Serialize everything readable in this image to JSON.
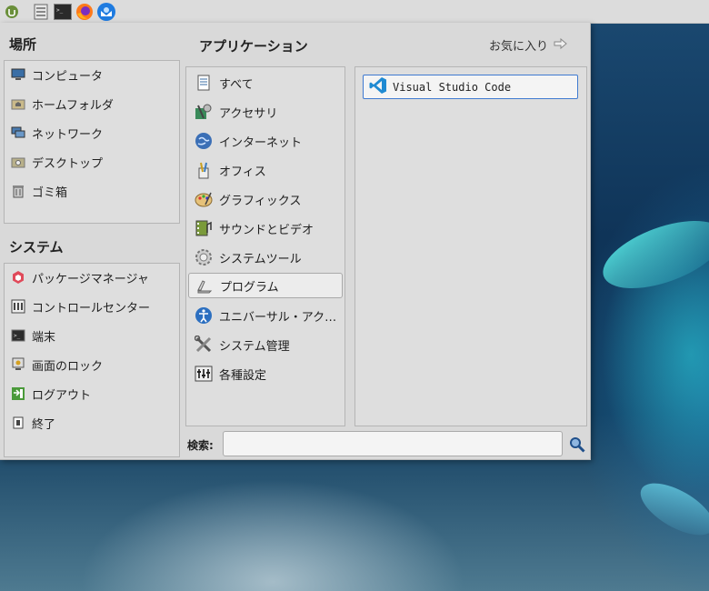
{
  "panel": {
    "icons": [
      "mint-menu-icon",
      "file-manager-icon",
      "terminal-icon",
      "firefox-icon",
      "thunderbird-icon"
    ]
  },
  "places": {
    "heading": "場所",
    "items": [
      {
        "label": "コンピュータ",
        "icon": "computer-icon"
      },
      {
        "label": "ホームフォルダ",
        "icon": "home-folder-icon"
      },
      {
        "label": "ネットワーク",
        "icon": "network-icon"
      },
      {
        "label": "デスクトップ",
        "icon": "desktop-icon"
      },
      {
        "label": "ゴミ箱",
        "icon": "trash-icon"
      }
    ]
  },
  "system": {
    "heading": "システム",
    "items": [
      {
        "label": "パッケージマネージャ",
        "icon": "package-manager-icon"
      },
      {
        "label": "コントロールセンター",
        "icon": "control-center-icon"
      },
      {
        "label": "端末",
        "icon": "terminal-icon"
      },
      {
        "label": "画面のロック",
        "icon": "lock-screen-icon"
      },
      {
        "label": "ログアウト",
        "icon": "logout-icon"
      },
      {
        "label": "終了",
        "icon": "shutdown-icon"
      }
    ]
  },
  "applications": {
    "heading": "アプリケーション",
    "favorites_label": "お気に入り",
    "categories": [
      {
        "label": "すべて",
        "icon": "all-apps-icon"
      },
      {
        "label": "アクセサリ",
        "icon": "accessories-icon"
      },
      {
        "label": "インターネット",
        "icon": "internet-icon"
      },
      {
        "label": "オフィス",
        "icon": "office-icon"
      },
      {
        "label": "グラフィックス",
        "icon": "graphics-icon"
      },
      {
        "label": "サウンドとビデオ",
        "icon": "sound-video-icon"
      },
      {
        "label": "システムツール",
        "icon": "system-tools-icon"
      },
      {
        "label": "プログラム",
        "icon": "programming-icon",
        "selected": true
      },
      {
        "label": "ユニバーサル・アク…",
        "icon": "universal-access-icon"
      },
      {
        "label": "システム管理",
        "icon": "administration-icon"
      },
      {
        "label": "各種設定",
        "icon": "preferences-icon"
      }
    ],
    "apps": [
      {
        "label": "Visual Studio Code",
        "icon": "vscode-icon"
      }
    ]
  },
  "search": {
    "label": "検索:",
    "value": "",
    "placeholder": ""
  }
}
